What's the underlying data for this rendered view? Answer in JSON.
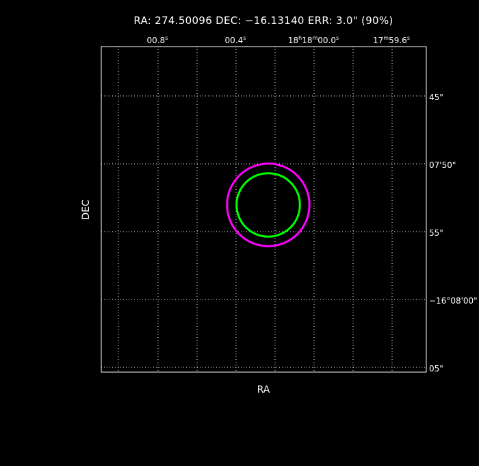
{
  "chart_data": {
    "type": "scatter",
    "title": "RA: 274.50096   DEC: −16.13140   ERR: 3.0\" (90%)",
    "xlabel": "RA",
    "ylabel": "DEC",
    "ra_center": 274.50096,
    "dec_center": -16.1314,
    "error_radius_arcsec": 3.0,
    "confidence": "90%",
    "x_ticks": [
      {
        "label": "00.8",
        "sup": "s"
      },
      {
        "label": "00.4",
        "sup": "s"
      },
      {
        "label": "18ᴴ18ᴹ",
        "sup": "",
        "parts": [
          [
            "18",
            ""
          ],
          [
            "h",
            "sup"
          ],
          [
            "18",
            ""
          ],
          [
            "m",
            "sup"
          ],
          [
            "00.0",
            ""
          ],
          [
            "s",
            "sup"
          ]
        ]
      },
      {
        "label": "17ᴹ",
        "sup": "",
        "parts": [
          [
            "17",
            ""
          ],
          [
            "m",
            "sup"
          ],
          [
            "59.6",
            ""
          ],
          [
            "s",
            "sup"
          ]
        ]
      }
    ],
    "y_ticks": [
      "45\"",
      "07'50\"",
      "55\"",
      "−16°08'00\"",
      "05\""
    ],
    "circles": [
      {
        "name": "",
        "color": "#ff00ff",
        "radius_arcsec": 4.0
      },
      {
        "name": "",
        "color": "#00ff00",
        "radius_arcsec": 3.0
      }
    ],
    "grid": true,
    "colors": {
      "background": "#000000",
      "frame": "#ffffff",
      "outer_circle": "#ff00ff",
      "inner_circle": "#00ff00"
    }
  }
}
